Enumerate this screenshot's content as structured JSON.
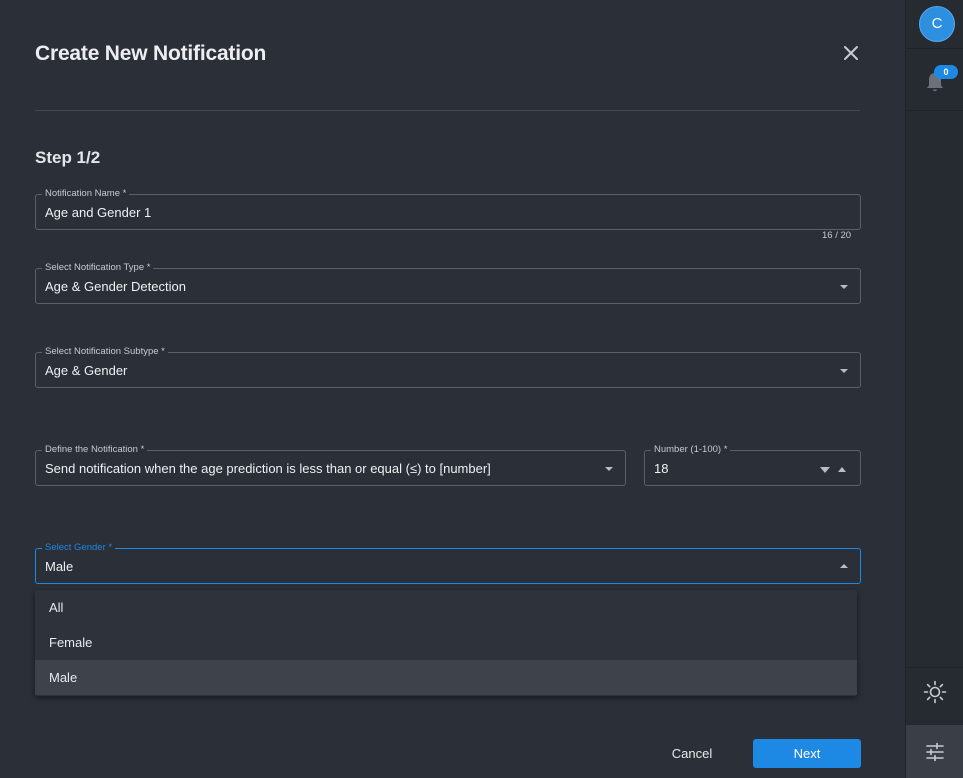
{
  "dialog": {
    "title": "Create New Notification",
    "step": "Step 1/2"
  },
  "fields": {
    "name": {
      "label": "Notification Name *",
      "value": "Age and Gender 1",
      "counter": "16 / 20"
    },
    "type": {
      "label": "Select Notification Type *",
      "value": "Age & Gender Detection"
    },
    "subtype": {
      "label": "Select Notification Subtype *",
      "value": "Age & Gender"
    },
    "define": {
      "label": "Define the Notification *",
      "value": "Send notification when the age prediction is less than or equal (≤) to [number]"
    },
    "number": {
      "label": "Number (1-100) *",
      "value": "18"
    },
    "gender": {
      "label": "Select Gender *",
      "value": "Male"
    }
  },
  "gender_options": [
    "All",
    "Female",
    "Male"
  ],
  "gender_selected_index": 2,
  "buttons": {
    "cancel": "Cancel",
    "next": "Next"
  },
  "rail": {
    "avatar_initial": "C",
    "notification_count": "0",
    "icons": [
      "bell-icon",
      "sun-icon",
      "tune-icon"
    ]
  },
  "colors": {
    "accent": "#1e88e5",
    "background": "#2b2f37"
  }
}
